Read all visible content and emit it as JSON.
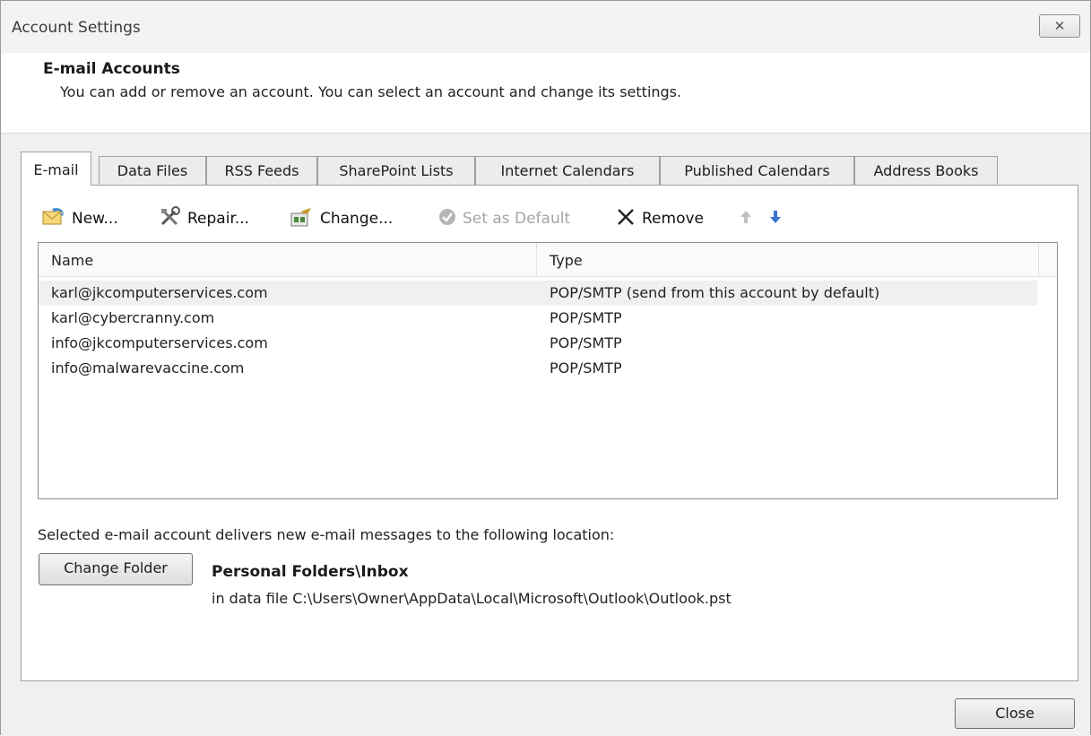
{
  "window": {
    "title": "Account Settings",
    "close_glyph": "✕"
  },
  "header": {
    "title": "E-mail Accounts",
    "description": "You can add or remove an account. You can select an account and change its settings."
  },
  "tabs": [
    {
      "label": "E-mail",
      "active": true
    },
    {
      "label": "Data Files"
    },
    {
      "label": "RSS Feeds"
    },
    {
      "label": "SharePoint Lists"
    },
    {
      "label": "Internet Calendars"
    },
    {
      "label": "Published Calendars"
    },
    {
      "label": "Address Books"
    }
  ],
  "toolbar": {
    "new_label": "New...",
    "repair_label": "Repair...",
    "change_label": "Change...",
    "set_default_label": "Set as Default",
    "remove_label": "Remove"
  },
  "accounts_table": {
    "columns": [
      "Name",
      "Type"
    ],
    "rows": [
      {
        "name": "karl@jkcomputerservices.com",
        "type": "POP/SMTP (send from this account by default)",
        "selected": true
      },
      {
        "name": "karl@cybercranny.com",
        "type": "POP/SMTP"
      },
      {
        "name": "info@jkcomputerservices.com",
        "type": "POP/SMTP"
      },
      {
        "name": "info@malwarevaccine.com",
        "type": "POP/SMTP"
      }
    ]
  },
  "delivery": {
    "label": "Selected e-mail account delivers new e-mail messages to the following location:",
    "change_folder_label": "Change Folder",
    "folder_name": "Personal Folders\\Inbox",
    "data_file_path": "in data file C:\\Users\\Owner\\AppData\\Local\\Microsoft\\Outlook\\Outlook.pst"
  },
  "footer": {
    "close_label": "Close"
  },
  "colors": {
    "dialog_bg": "#f0f0f0",
    "panel_bg": "#ffffff",
    "border": "#a0a0a0",
    "disabled_text": "#a5a5a5",
    "arrow_down_blue": "#3b73d1"
  }
}
